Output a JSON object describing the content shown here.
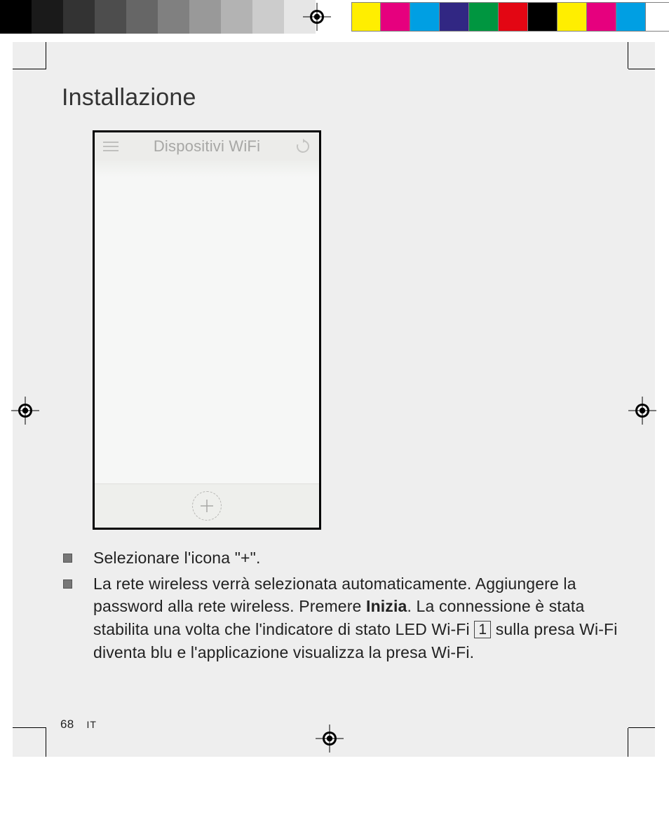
{
  "colorbar_left": [
    "#000000",
    "#1a1a1a",
    "#333333",
    "#4d4d4d",
    "#666666",
    "#808080",
    "#999999",
    "#b3b3b3",
    "#cccccc",
    "#e6e6e6",
    "#ffffff"
  ],
  "colorbar_right": [
    "#ffee00",
    "#e6007e",
    "#009fe3",
    "#312783",
    "#009640",
    "#e30613",
    "#000000",
    "#ffee00",
    "#e6007e",
    "#009fe3",
    "#ffffff"
  ],
  "colorbar_right_border": "#808080",
  "heading": "Installazione",
  "phone": {
    "title": "Dispositivi WiFi",
    "menu_icon": "menu-icon",
    "refresh_icon": "refresh-icon",
    "add_icon": "plus-icon"
  },
  "bullets": {
    "b1": "Selezionare l'icona \"+\".",
    "b2_pre": "La rete wireless verrà selezionata automaticamente. Aggiungere la password alla rete wireless. Premere ",
    "b2_bold": "Inizia",
    "b2_mid": ". La connessione è stata stabilita una volta che l'indicatore di stato LED Wi-Fi ",
    "b2_ref": "1",
    "b2_post": " sulla presa Wi-Fi diventa blu e l'applicazione visualizza la presa Wi-Fi."
  },
  "footer": {
    "page": "68",
    "lang": "IT"
  }
}
